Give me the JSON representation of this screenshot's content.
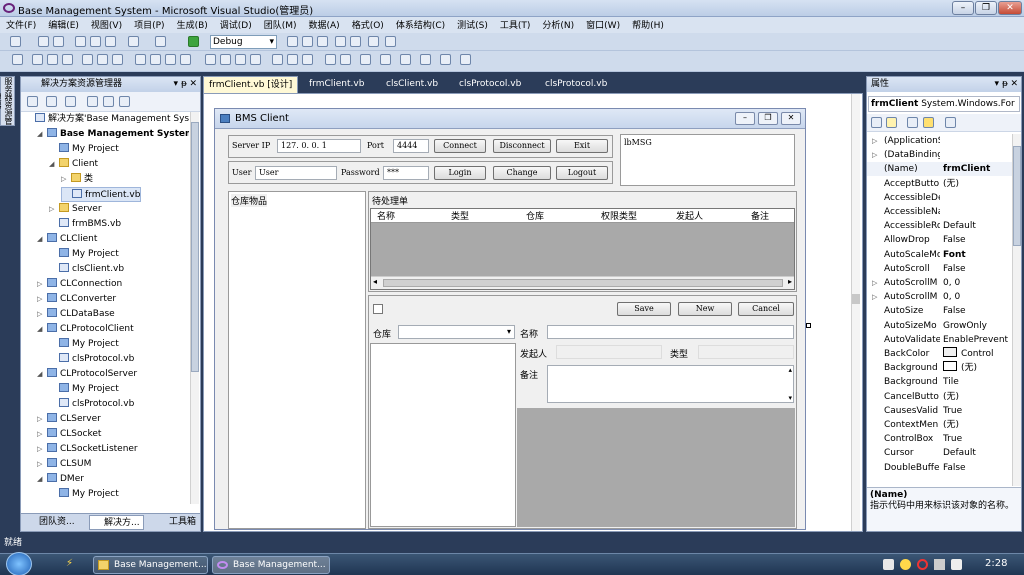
{
  "window": {
    "title": "Base Management System - Microsoft Visual Studio(管理员)",
    "min": "–",
    "max": "❐",
    "close": "✕"
  },
  "menu": [
    "文件(F)",
    "编辑(E)",
    "视图(V)",
    "项目(P)",
    "生成(B)",
    "调试(D)",
    "团队(M)",
    "数据(A)",
    "格式(O)",
    "体系结构(C)",
    "测试(S)",
    "工具(T)",
    "分析(N)",
    "窗口(W)",
    "帮助(H)"
  ],
  "toolbar": {
    "config": "Debug"
  },
  "solution_explorer": {
    "title": "解决方案资源管理器",
    "items": [
      {
        "label": "解决方案'Base Management Syst",
        "exp": "",
        "ico": "s"
      },
      {
        "label": "Base Management System",
        "exp": "◢",
        "ico": "p",
        "bold": true
      },
      {
        "label": "My Project",
        "exp": "",
        "ico": "p"
      },
      {
        "label": "Client",
        "exp": "◢",
        "ico": "f"
      },
      {
        "label": "类",
        "exp": "▷",
        "ico": "f"
      },
      {
        "label": "frmClient.vb",
        "exp": "",
        "ico": "s",
        "sel": true
      },
      {
        "label": "Server",
        "exp": "▷",
        "ico": "f"
      },
      {
        "label": "frmBMS.vb",
        "exp": "",
        "ico": "s"
      },
      {
        "label": "CLClient",
        "exp": "◢",
        "ico": "p"
      },
      {
        "label": "My Project",
        "exp": "",
        "ico": "p"
      },
      {
        "label": "clsClient.vb",
        "exp": "",
        "ico": "s"
      },
      {
        "label": "CLConnection",
        "exp": "▷",
        "ico": "p"
      },
      {
        "label": "CLConverter",
        "exp": "▷",
        "ico": "p"
      },
      {
        "label": "CLDataBase",
        "exp": "▷",
        "ico": "p"
      },
      {
        "label": "CLProtocolClient",
        "exp": "◢",
        "ico": "p"
      },
      {
        "label": "My Project",
        "exp": "",
        "ico": "p"
      },
      {
        "label": "clsProtocol.vb",
        "exp": "",
        "ico": "s"
      },
      {
        "label": "CLProtocolServer",
        "exp": "◢",
        "ico": "p"
      },
      {
        "label": "My Project",
        "exp": "",
        "ico": "p"
      },
      {
        "label": "clsProtocol.vb",
        "exp": "",
        "ico": "s"
      },
      {
        "label": "CLServer",
        "exp": "▷",
        "ico": "p"
      },
      {
        "label": "CLSocket",
        "exp": "▷",
        "ico": "p"
      },
      {
        "label": "CLSocketListener",
        "exp": "▷",
        "ico": "p"
      },
      {
        "label": "CLSUM",
        "exp": "▷",
        "ico": "p"
      },
      {
        "label": "DMer",
        "exp": "◢",
        "ico": "p"
      },
      {
        "label": "My Project",
        "exp": "",
        "ico": "p"
      }
    ],
    "bottom_tabs": [
      "团队资...",
      "解决方...",
      "工具箱"
    ]
  },
  "side_toolbox": "服务器资源管理器",
  "doc_tabs": [
    "frmClient.vb [设计]",
    "frmClient.vb",
    "clsClient.vb",
    "clsProtocol.vb",
    "clsProtocol.vb"
  ],
  "form": {
    "title": "BMS Client",
    "server_ip_label": "Server IP",
    "server_ip": "127.  0.  0.  1",
    "port_label": "Port",
    "port": "4444",
    "connect": "Connect",
    "disconnect": "Disconnect",
    "exit": "Exit",
    "user_label": "User",
    "user": "User",
    "password_label": "Password",
    "password": "***",
    "login": "Login",
    "change": "Change",
    "logout": "Logout",
    "msg": "lbMSG",
    "storage_title": "仓库物品",
    "pending_title": "待处理单",
    "columns": [
      "名称",
      "类型",
      "仓库",
      "权限类型",
      "发起人",
      "备注"
    ],
    "save": "Save",
    "new": "New",
    "cancel": "Cancel",
    "warehouse_label": "仓库",
    "name_label": "名称",
    "initiator_label": "发起人",
    "type_label": "类型",
    "note_label": "备注"
  },
  "properties": {
    "title": "属性",
    "object": "frmClient",
    "object_type": "System.Windows.For",
    "rows": [
      {
        "k": "(ApplicationS",
        "v": "",
        "exp": "▷"
      },
      {
        "k": "(DataBinding",
        "v": "",
        "exp": "▷"
      },
      {
        "k": "(Name)",
        "v": "frmClient",
        "bold": true
      },
      {
        "k": "AcceptButto",
        "v": "(无)"
      },
      {
        "k": "AccessibleDe",
        "v": ""
      },
      {
        "k": "AccessibleNa",
        "v": ""
      },
      {
        "k": "AccessibleRo",
        "v": "Default"
      },
      {
        "k": "AllowDrop",
        "v": "False"
      },
      {
        "k": "AutoScaleMo",
        "v": "Font",
        "bold": true
      },
      {
        "k": "AutoScroll",
        "v": "False"
      },
      {
        "k": "AutoScrollM",
        "v": "0, 0",
        "exp": "▷"
      },
      {
        "k": "AutoScrollM",
        "v": "0, 0",
        "exp": "▷"
      },
      {
        "k": "AutoSize",
        "v": "False"
      },
      {
        "k": "AutoSizeMo",
        "v": "GrowOnly"
      },
      {
        "k": "AutoValidate",
        "v": "EnablePrevent"
      },
      {
        "k": "BackColor",
        "v": "Control",
        "swatch": "#f0f0f0"
      },
      {
        "k": "Background",
        "v": "(无)",
        "swatch": "#ffffff"
      },
      {
        "k": "Background",
        "v": "Tile"
      },
      {
        "k": "CancelButto",
        "v": "(无)"
      },
      {
        "k": "CausesValid",
        "v": "True"
      },
      {
        "k": "ContextMen",
        "v": "(无)"
      },
      {
        "k": "ControlBox",
        "v": "True"
      },
      {
        "k": "Cursor",
        "v": "Default"
      },
      {
        "k": "DoubleBuffe",
        "v": "False"
      }
    ],
    "desc_title": "(Name)",
    "desc": "指示代码中用来标识该对象的名称。"
  },
  "status": "就绪",
  "taskbar": {
    "items": [
      "Base Management...",
      "Base Management..."
    ],
    "clock": "2:28"
  },
  "colors": {
    "ide_bg": "#2b3c59",
    "form_bg": "#f0f0f0",
    "grid_bg": "#a9a9a9"
  }
}
